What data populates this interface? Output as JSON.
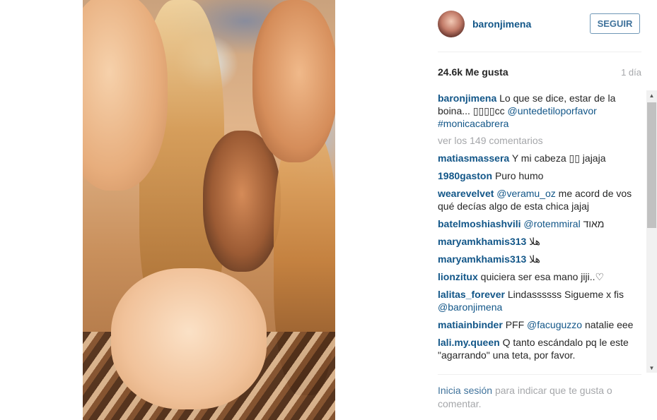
{
  "colors": {
    "username": "#125688",
    "muted": "#a5a7aa",
    "button_border": "#6f97b6",
    "link": "#3f729b"
  },
  "post": {
    "author": "baronjimena",
    "follow_label": "SEGUIR",
    "likes": "24.6k Me gusta",
    "time": "1 día"
  },
  "caption": {
    "user": "baronjimena",
    "text": "Lo que se dice, estar de la boina... ▯▯▯▯cc",
    "mention": "@untedetiloporfavor",
    "tag": "#monicacabrera"
  },
  "view_all_comments": "ver los 149 comentarios",
  "comments": [
    {
      "user": "matiasmassera",
      "pre": "Y mi cabeza ▯▯ jajaja",
      "mention": "",
      "post": ""
    },
    {
      "user": "1980gaston",
      "pre": "Puro humo",
      "mention": "",
      "post": ""
    },
    {
      "user": "wearevelvet",
      "pre": "",
      "mention": "@veramu_oz",
      "post": "me acord de vos qué decías algo de esta chica jajaj"
    },
    {
      "user": "batelmoshiashvili",
      "pre": "",
      "mention": "@rotemmiral",
      "post": "מאוד"
    },
    {
      "user": "maryamkhamis313",
      "pre": "هلا",
      "mention": "",
      "post": ""
    },
    {
      "user": "maryamkhamis313",
      "pre": "هلا",
      "mention": "",
      "post": ""
    },
    {
      "user": "lionzitux",
      "pre": "quiciera ser esa mano jiji..♡",
      "mention": "",
      "post": ""
    },
    {
      "user": "lalitas_forever",
      "pre": "Lindassssss Sigueme x fis",
      "mention": "@baronjimena",
      "post": ""
    },
    {
      "user": "matiainbinder",
      "pre": "PFF",
      "mention": "@facuguzzo",
      "post": "natalie eee"
    },
    {
      "user": "lali.my.queen",
      "pre": "Q tanto escándalo pq le este \"agarrando\" una teta, por favor.",
      "mention": "",
      "post": ""
    }
  ],
  "footer": {
    "login_link": "Inicia sesión",
    "rest": "para indicar que te gusta o comentar."
  }
}
